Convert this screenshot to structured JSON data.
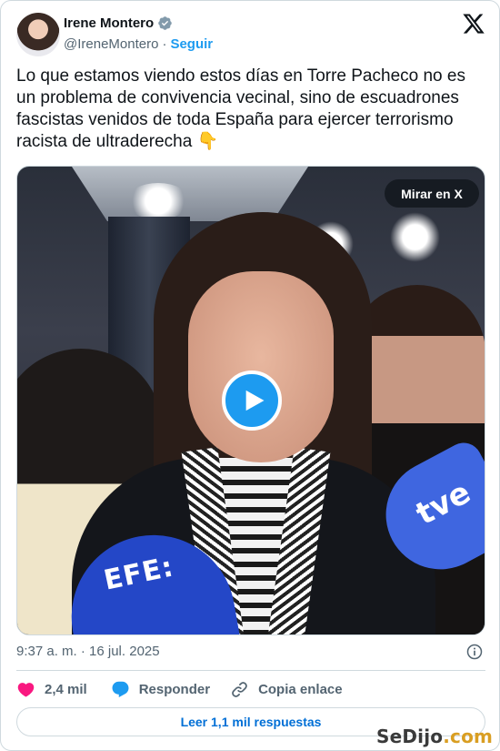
{
  "author": {
    "name": "Irene Montero",
    "handle": "@IreneMontero",
    "separator": "·",
    "follow_label": "Seguir"
  },
  "tweet": {
    "text": "Lo que estamos viendo estos días en Torre Pacheco no es un problema de convivencia vecinal, sino de escuadrones fascistas venidos de toda España para ejercer terrorismo racista de ultraderecha 👇"
  },
  "media": {
    "watch_label": "Mirar en X",
    "mic_left_text": "EFE:",
    "mic_right_text": "tve"
  },
  "meta": {
    "timestamp": "9:37 a. m. · 16 jul. 2025"
  },
  "actions": {
    "likes": "2,4 mil",
    "reply_label": "Responder",
    "copy_label": "Copia enlace"
  },
  "replies_button": "Leer 1,1 mil respuestas",
  "watermark": {
    "part1": "SeDijo",
    "part2": ".com"
  },
  "colors": {
    "accent": "#1d9bf0",
    "like": "#f91880",
    "link": "#006fd6",
    "muted": "#536471"
  },
  "icons": [
    "verified-badge-icon",
    "x-logo-icon",
    "play-icon",
    "info-icon",
    "heart-icon",
    "reply-bubble-icon",
    "link-icon"
  ]
}
